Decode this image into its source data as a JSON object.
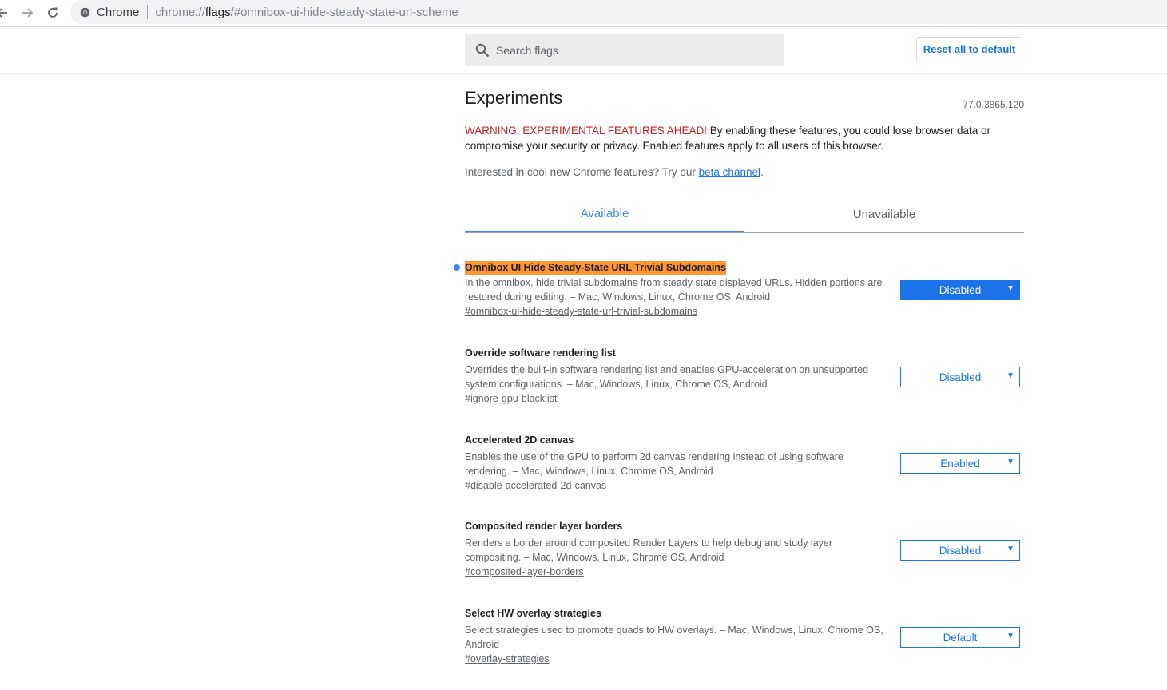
{
  "browser": {
    "site_name": "Chrome",
    "url_scheme": "chrome://",
    "url_host": "flags",
    "url_path": "/#omnibox-ui-hide-steady-state-url-scheme"
  },
  "header": {
    "search_placeholder": "Search flags",
    "reset_label": "Reset all to default"
  },
  "page": {
    "title": "Experiments",
    "version": "77.0.3865.120",
    "warning_label": "WARNING: EXPERIMENTAL FEATURES AHEAD!",
    "warning_text": " By enabling these features, you could lose browser data or compromise your security or privacy. Enabled features apply to all users of this browser.",
    "promo_text": "Interested in cool new Chrome features? Try our ",
    "promo_link": "beta channel",
    "promo_end": "."
  },
  "tabs": [
    {
      "label": "Available",
      "active": true
    },
    {
      "label": "Unavailable",
      "active": false
    }
  ],
  "experiments": [
    {
      "title": "Omnibox UI Hide Steady-State URL Trivial Subdomains",
      "description": "In the omnibox, hide trivial subdomains from steady state displayed URLs. Hidden portions are restored during editing. – Mac, Windows, Linux, Chrome OS, Android",
      "link": "#omnibox-ui-hide-steady-state-url-trivial-subdomains",
      "value": "Disabled",
      "highlighted": true
    },
    {
      "title": "Override software rendering list",
      "description": "Overrides the built-in software rendering list and enables GPU-acceleration on unsupported system configurations. – Mac, Windows, Linux, Chrome OS, Android",
      "link": "#ignore-gpu-blacklist",
      "value": "Disabled",
      "highlighted": false
    },
    {
      "title": "Accelerated 2D canvas",
      "description": "Enables the use of the GPU to perform 2d canvas rendering instead of using software rendering. – Mac, Windows, Linux, Chrome OS, Android",
      "link": "#disable-accelerated-2d-canvas",
      "value": "Enabled",
      "highlighted": false
    },
    {
      "title": "Composited render layer borders",
      "description": "Renders a border around composited Render Layers to help debug and study layer compositing. – Mac, Windows, Linux, Chrome OS, Android",
      "link": "#composited-layer-borders",
      "value": "Disabled",
      "highlighted": false
    },
    {
      "title": "Select HW overlay strategies",
      "description": "Select strategies used to promote quads to HW overlays. – Mac, Windows, Linux, Chrome OS, Android",
      "link": "#overlay-strategies",
      "value": "Default",
      "highlighted": false
    }
  ],
  "colors": {
    "accent": "#1a73e8",
    "tab_active": "#4285f4",
    "warning": "#c5221f",
    "highlight": "#ff9632"
  }
}
